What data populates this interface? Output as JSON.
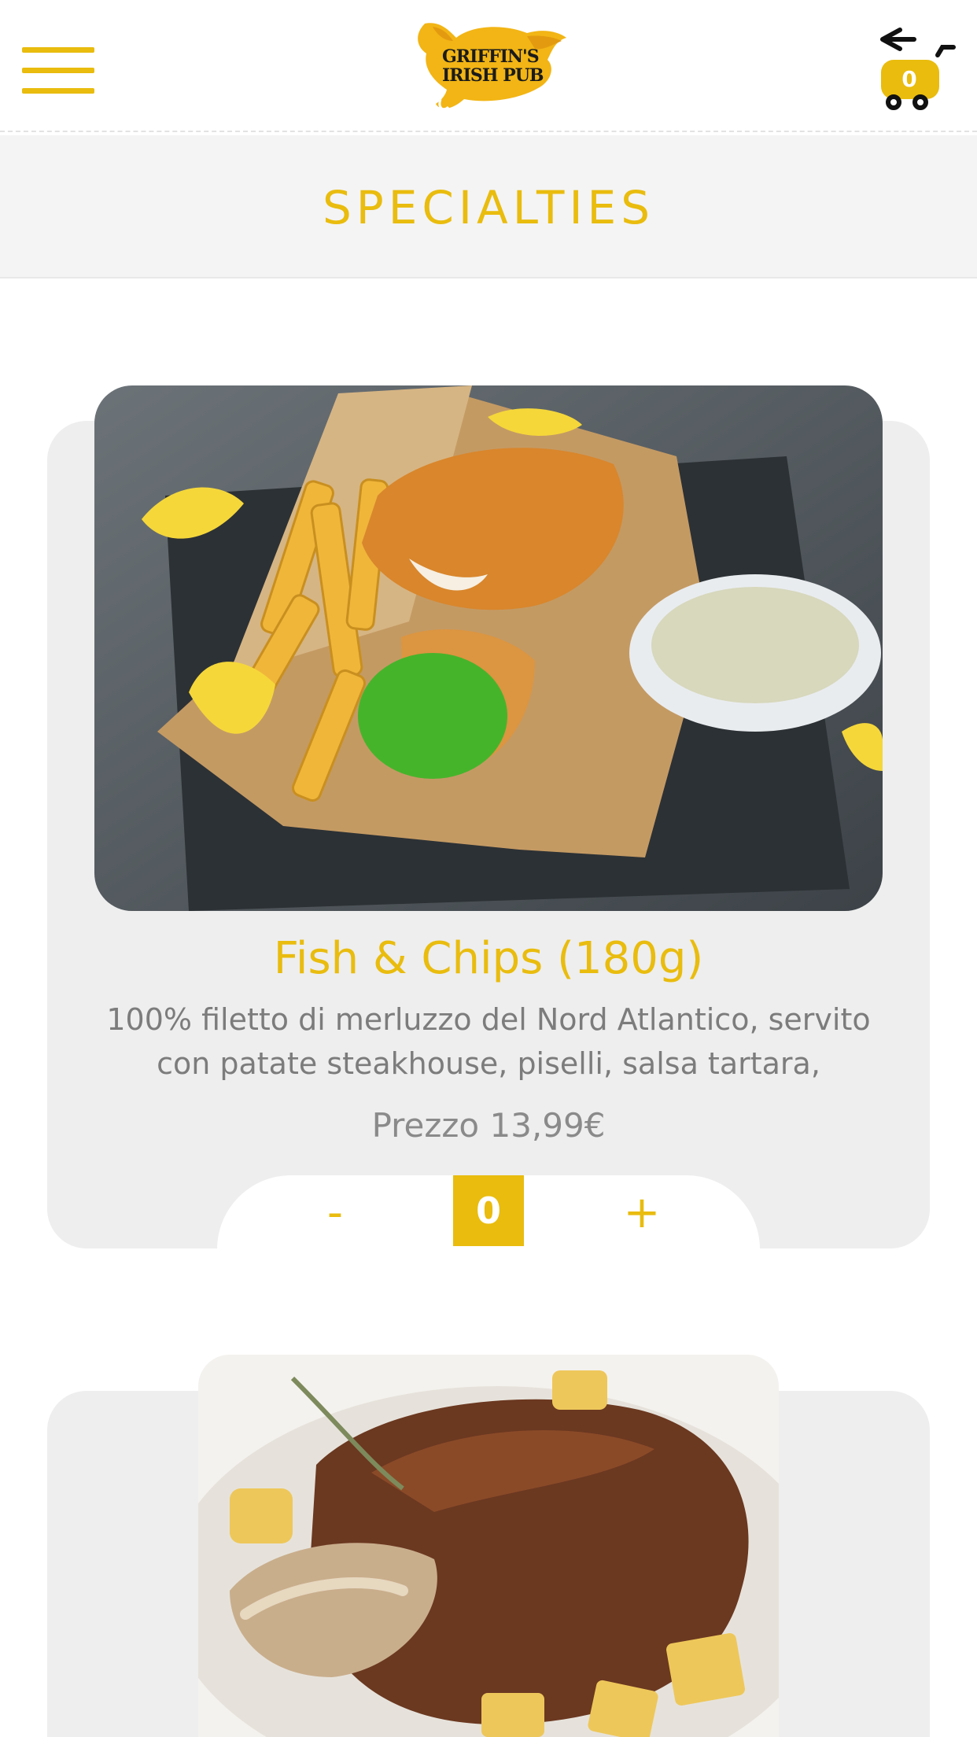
{
  "header": {
    "menu_icon": "hamburger-icon",
    "logo": {
      "line1": "GRIFFIN'S",
      "line2": "IRISH PUB"
    },
    "cart": {
      "icon": "cart-icon",
      "count": "0"
    }
  },
  "category": {
    "title": "SPECIALTIES"
  },
  "products": [
    {
      "name": "Fish & Chips (180g)",
      "description": "100% filetto di merluzzo del Nord Atlantico, servito con patate steakhouse, piselli, salsa tartara,",
      "price": "Prezzo 13,99€",
      "image": "fish-and-chips-photo",
      "quantity": {
        "minus": "-",
        "value": "0",
        "plus": "+"
      }
    },
    {
      "image": "roast-shank-photo"
    }
  ],
  "colors": {
    "accent": "#e9bc0e",
    "card_bg": "#eeeeee",
    "band_bg": "#f4f4f4"
  }
}
